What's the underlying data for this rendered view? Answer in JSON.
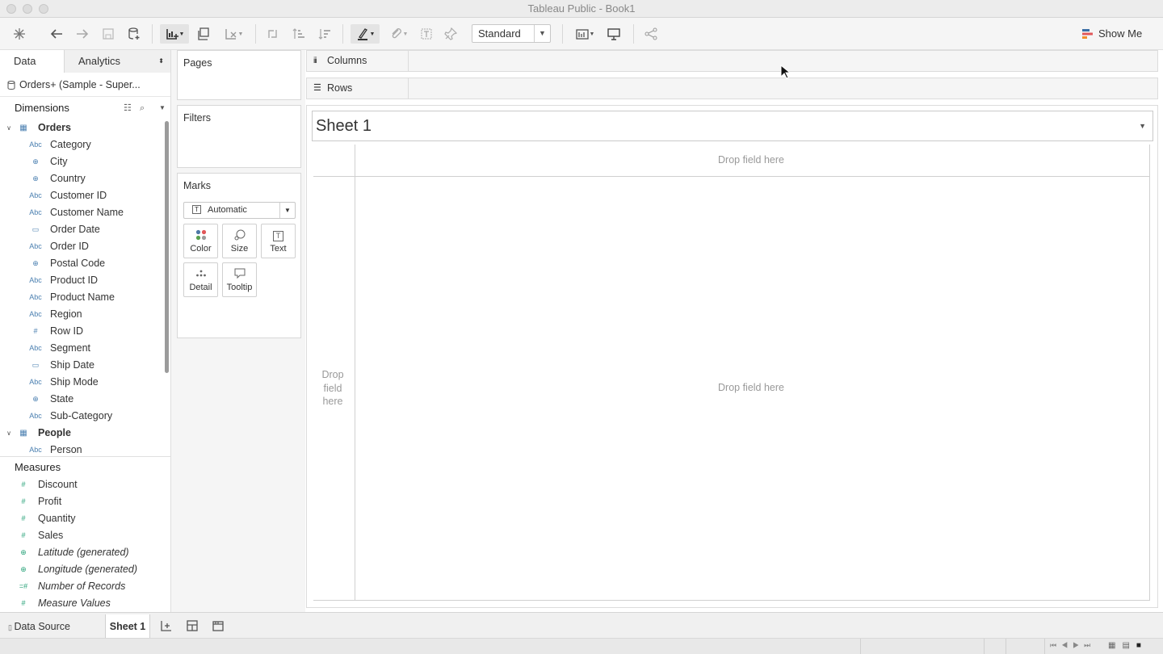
{
  "window": {
    "title": "Tableau Public - Book1"
  },
  "toolbar": {
    "fit_dropdown": "Standard",
    "show_me": "Show Me"
  },
  "left_pane": {
    "tabs": [
      "Data",
      "Analytics"
    ],
    "data_source": "Orders+ (Sample - Super...",
    "dimensions_label": "Dimensions",
    "orders": {
      "label": "Orders",
      "fields": [
        {
          "type": "Abc",
          "name": "Category"
        },
        {
          "type": "geo",
          "name": "City"
        },
        {
          "type": "geo",
          "name": "Country"
        },
        {
          "type": "Abc",
          "name": "Customer ID"
        },
        {
          "type": "Abc",
          "name": "Customer Name"
        },
        {
          "type": "date",
          "name": "Order Date"
        },
        {
          "type": "Abc",
          "name": "Order ID"
        },
        {
          "type": "geo",
          "name": "Postal Code"
        },
        {
          "type": "Abc",
          "name": "Product ID"
        },
        {
          "type": "Abc",
          "name": "Product Name"
        },
        {
          "type": "Abc",
          "name": "Region"
        },
        {
          "type": "#",
          "name": "Row ID"
        },
        {
          "type": "Abc",
          "name": "Segment"
        },
        {
          "type": "date",
          "name": "Ship Date"
        },
        {
          "type": "Abc",
          "name": "Ship Mode"
        },
        {
          "type": "geo",
          "name": "State"
        },
        {
          "type": "Abc",
          "name": "Sub-Category"
        }
      ]
    },
    "people": {
      "label": "People",
      "fields": [
        {
          "type": "Abc",
          "name": "Person"
        }
      ]
    },
    "measures_label": "Measures",
    "measures": [
      {
        "type": "#",
        "name": "Discount"
      },
      {
        "type": "#",
        "name": "Profit"
      },
      {
        "type": "#",
        "name": "Quantity"
      },
      {
        "type": "#",
        "name": "Sales"
      },
      {
        "type": "geo",
        "name": "Latitude (generated)"
      },
      {
        "type": "geo",
        "name": "Longitude (generated)"
      },
      {
        "type": "=#",
        "name": "Number of Records"
      },
      {
        "type": "#",
        "name": "Measure Values"
      }
    ]
  },
  "cards": {
    "pages": "Pages",
    "filters": "Filters",
    "marks": "Marks",
    "mark_type": "Automatic",
    "mark_buttons": [
      "Color",
      "Size",
      "Text",
      "Detail",
      "Tooltip"
    ]
  },
  "shelves": {
    "columns": "Columns",
    "rows": "Rows"
  },
  "view": {
    "sheet_title": "Sheet 1",
    "drop_top": "Drop field here",
    "drop_center": "Drop field here",
    "drop_left": "Drop field here"
  },
  "bottom": {
    "data_source_tab": "Data Source",
    "sheet_tab": "Sheet 1"
  },
  "colors": {
    "accent": "#4a7fb0",
    "measure": "#2aa37a"
  }
}
